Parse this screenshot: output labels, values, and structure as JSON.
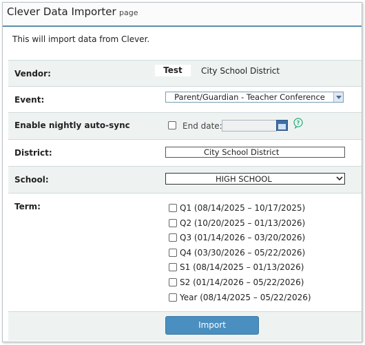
{
  "header": {
    "title": "Clever Data Importer",
    "subtitle": "page"
  },
  "intro": "This will import data from Clever.",
  "vendor": {
    "label": "Vendor:",
    "name": "Test",
    "district": "City School District"
  },
  "event": {
    "label": "Event:",
    "selected": "Parent/Guardian - Teacher Conference"
  },
  "autosync": {
    "label": "Enable nightly auto-sync",
    "end_date_label": "End date:",
    "end_date_value": ""
  },
  "district": {
    "label": "District:",
    "value": "City School District"
  },
  "school": {
    "label": "School:",
    "selected": "HIGH SCHOOL"
  },
  "term": {
    "label": "Term:",
    "options": [
      "Q1 (08/14/2025 – 10/17/2025)",
      "Q2 (10/20/2025 – 01/13/2026)",
      "Q3 (01/14/2026 – 03/20/2026)",
      "Q4 (03/30/2026 – 05/22/2026)",
      "S1 (08/14/2025 – 01/13/2026)",
      "S2 (01/14/2026 – 05/22/2026)",
      "Year (08/14/2025 – 05/22/2026)"
    ]
  },
  "actions": {
    "import_label": "Import"
  },
  "icons": {
    "calendar": "calendar-icon",
    "help": "help-icon",
    "dropdown": "chevron-down-icon"
  },
  "colors": {
    "accent": "#5a8fab",
    "button": "#4a8fc0",
    "row_shade": "#eef3f2"
  }
}
